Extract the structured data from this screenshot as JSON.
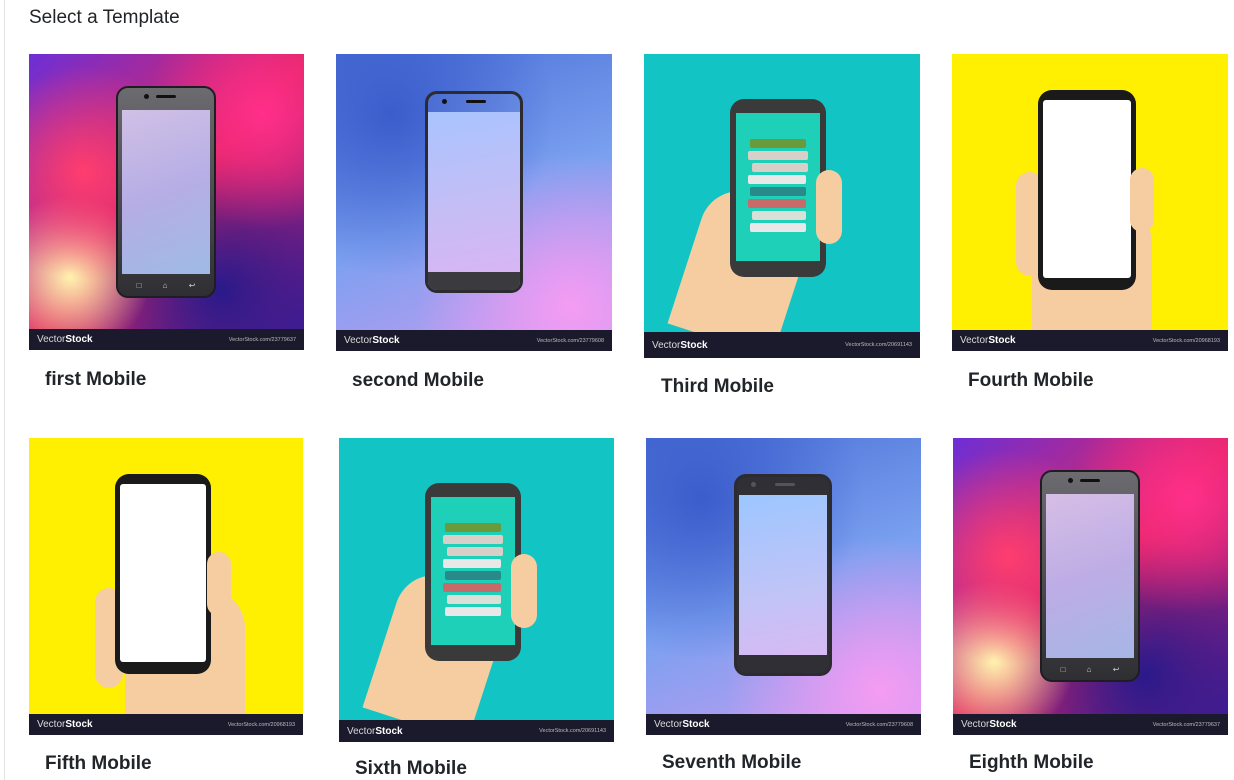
{
  "page": {
    "title": "Select a Template"
  },
  "watermark": {
    "brand_prefix": "Vector",
    "brand_suffix": "Stock"
  },
  "templates": [
    {
      "name": "first Mobile",
      "url": "VectorStock.com/23779637"
    },
    {
      "name": "second Mobile",
      "url": "VectorStock.com/23779608"
    },
    {
      "name": "Third Mobile",
      "url": "VectorStock.com/20691143"
    },
    {
      "name": "Fourth Mobile",
      "url": "VectorStock.com/20968193"
    },
    {
      "name": "Fifth Mobile",
      "url": "VectorStock.com/20968193"
    },
    {
      "name": "Sixth Mobile",
      "url": "VectorStock.com/20691143"
    },
    {
      "name": "Seventh Mobile",
      "url": "VectorStock.com/23779608"
    },
    {
      "name": "Eighth Mobile",
      "url": "VectorStock.com/23779637"
    }
  ],
  "colors": {
    "teal": "#12c4c4",
    "yellow": "#fef000",
    "watermark_bar": "#1b1a2c",
    "skin": "#f6cda0"
  }
}
